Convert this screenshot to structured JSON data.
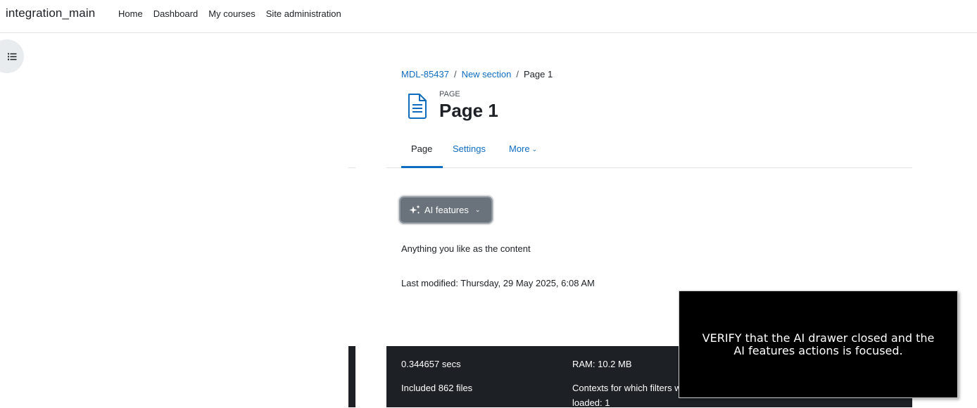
{
  "navbar": {
    "brand": "integration_main",
    "links": [
      "Home",
      "Dashboard",
      "My courses",
      "Site administration"
    ]
  },
  "breadcrumb": {
    "items": [
      "MDL-85437",
      "New section",
      "Page 1"
    ],
    "separator": "/"
  },
  "header": {
    "type_label": "PAGE",
    "title": "Page 1"
  },
  "tabs": [
    "Page",
    "Settings",
    "More"
  ],
  "ai_button": {
    "label": "AI features"
  },
  "content": {
    "body": "Anything you like as the content",
    "last_modified": "Last modified: Thursday, 29 May 2025, 6:08 AM"
  },
  "footer": {
    "time": "0.344657 secs",
    "ram": "RAM: 10.2 MB",
    "files": "Included 862 files",
    "contexts_line1": "Contexts for which filters were",
    "contexts_line2": "loaded: 1"
  },
  "overlay": {
    "message": "VERIFY that the AI drawer closed and the AI features actions is focused."
  },
  "colors": {
    "link": "#0f6cbf",
    "footer_bg": "#1d2125",
    "ai_button_bg": "#6a737b",
    "page_icon": "#0f6cbf"
  }
}
